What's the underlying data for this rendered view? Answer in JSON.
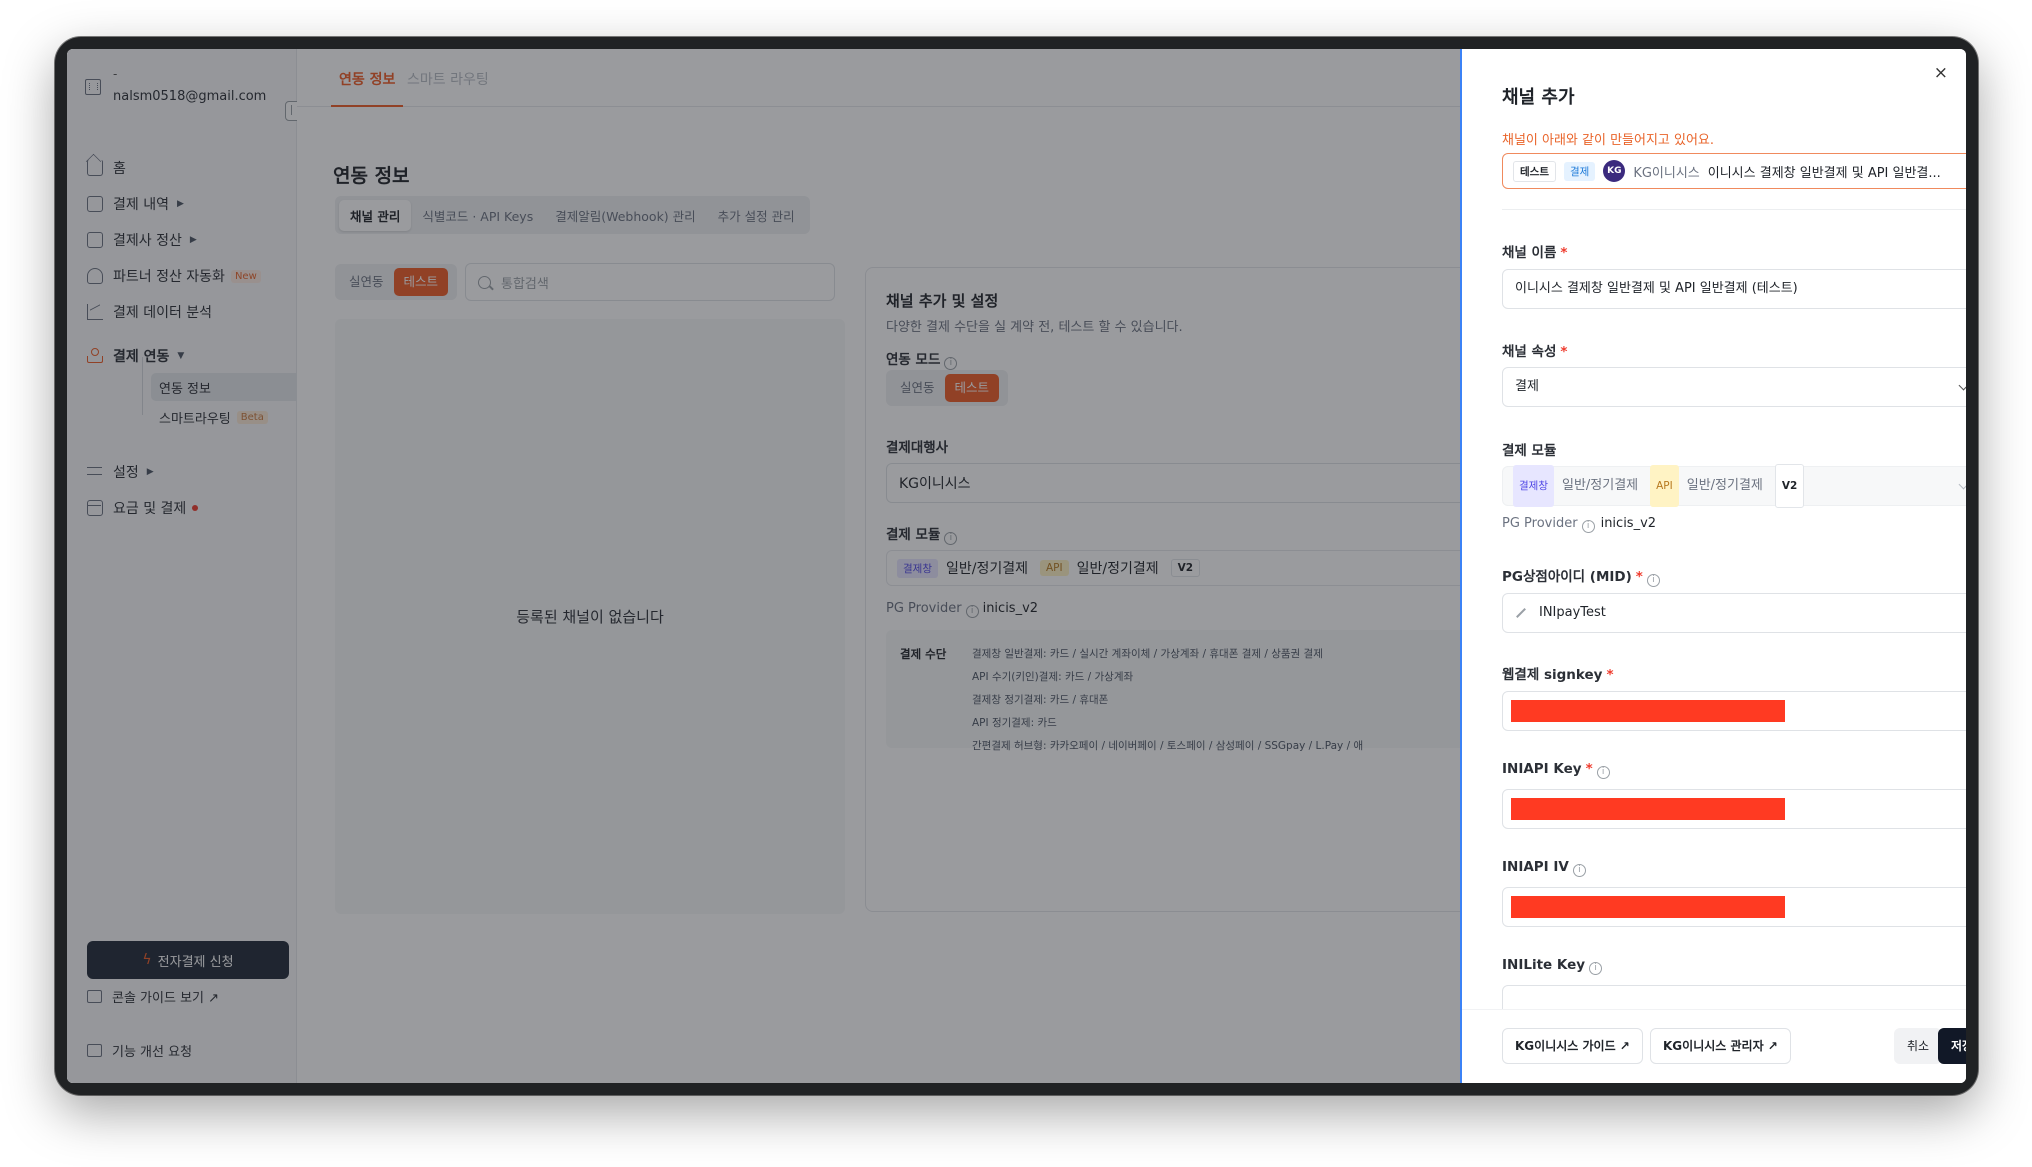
{
  "sidebar": {
    "account_name": "-",
    "account_email": "nalsm0518@gmail.com",
    "items": [
      {
        "label": "홈"
      },
      {
        "label": "결제 내역"
      },
      {
        "label": "결제사 정산"
      },
      {
        "label": "파트너 정산 자동화",
        "badge": "New"
      },
      {
        "label": "결제 데이터 분석"
      },
      {
        "label": "결제 연동"
      },
      {
        "label": "설정"
      },
      {
        "label": "요금 및 결제"
      }
    ],
    "sub_items": [
      {
        "label": "연동 정보"
      },
      {
        "label": "스마트라우팅",
        "badge": "Beta"
      }
    ],
    "apply_button": "전자결제 신청",
    "guide_link": "콘솔 가이드 보기 ↗",
    "request_link": "기능 개선 요청"
  },
  "topnav": {
    "tabs": [
      "연동 정보",
      "스마트 라우팅"
    ]
  },
  "main": {
    "page_title": "연동 정보",
    "subtabs": [
      "채널 관리",
      "식별코드 · API Keys",
      "결제알림(Webhook) 관리",
      "추가 설정 관리"
    ],
    "env_toggle": [
      "실연동",
      "테스트"
    ],
    "search_placeholder": "통합검색",
    "empty_text": "등록된 채널이 없습니다"
  },
  "setup_card": {
    "title": "채널 추가 및 설정",
    "desc": "다양한 결제 수단을 실 계약 전, 테스트 할 수 있습니다.",
    "mode_label": "연동 모드",
    "mode_options": [
      "실연동",
      "테스트"
    ],
    "pg_label": "결제대행사",
    "pg_value": "KG이니시스",
    "module_label": "결제 모듈",
    "module": {
      "tag1": "결제창",
      "text1": "일반/정기결제",
      "tag2": "API",
      "text2": "일반/정기결제",
      "version": "V2"
    },
    "pg_provider_label": "PG Provider",
    "pg_provider_value": "inicis_v2",
    "methods_title": "결제 수단",
    "methods": [
      "결제창 일반결제: 카드 / 실시간 계좌이체 / 가상계좌 / 휴대폰 결제 / 상품권 결제",
      "API 수기(키인)결제: 카드 / 가상계좌",
      "결제창 정기결제: 카드 / 휴대폰",
      "API 정기결제: 카드",
      "간편결제 허브형: 카카오페이 / 네이버페이 / 토스페이 / 삼성페이 / SSGpay / L.Pay / 애"
    ]
  },
  "drawer": {
    "title": "채널 추가",
    "close": "×",
    "notice": "채널이 아래와 같이 만들어지고 있어요.",
    "preview": {
      "tag_env": "테스트",
      "tag_type": "결제",
      "logo": "KG",
      "pg": "KG이니시스",
      "name": "이니시스 결제창 일반결제 및 API 일반결..."
    },
    "fields": {
      "channel_name_label": "채널 이름",
      "channel_name_value": "이니시스 결제창 일반결제 및 API 일반결제 (테스트)",
      "channel_attr_label": "채널 속성",
      "channel_attr_value": "결제",
      "module_label": "결제 모듈",
      "pg_provider_label": "PG Provider",
      "pg_provider_value": "inicis_v2",
      "mid_label": "PG상점아이디 (MID)",
      "mid_value": "INIpayTest",
      "signkey_label": "웹결제 signkey",
      "iniapi_key_label": "INIAPI Key",
      "iniapi_iv_label": "INIAPI IV",
      "inilite_key_label": "INILite Key"
    },
    "required_mark": "*",
    "footer": {
      "guide": "KG이니시스 가이드 ↗",
      "admin": "KG이니시스 관리자 ↗",
      "cancel": "취소",
      "save": "저장"
    }
  },
  "colors": {
    "accent": "#ef5b25",
    "redaction": "#ff3a22",
    "drawer_border": "#3b82f6",
    "primary_dark": "#111827"
  }
}
